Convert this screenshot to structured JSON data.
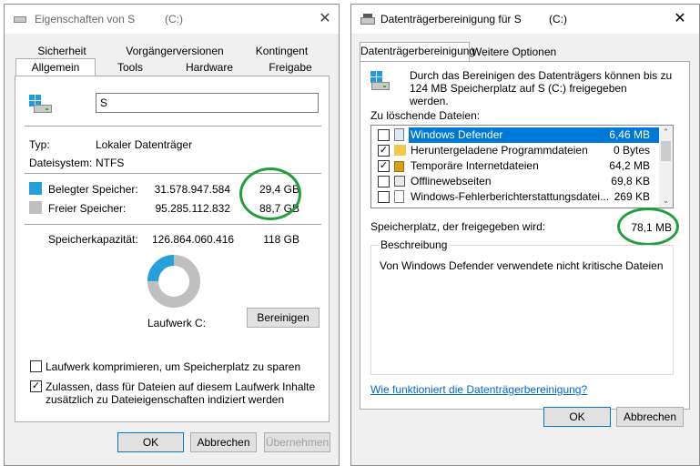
{
  "left_dialog": {
    "title": "Eigenschaften von S",
    "title_drive": "(C:)",
    "tabs_row1": [
      "Sicherheit",
      "Vorgängerversionen",
      "Kontingent"
    ],
    "tabs_row2": [
      "Allgemein",
      "Tools",
      "Hardware",
      "Freigabe"
    ],
    "volume_name": "S",
    "type_label": "Typ:",
    "type_value": "Lokaler Datenträger",
    "fs_label": "Dateisystem:",
    "fs_value": "NTFS",
    "used_label": "Belegter Speicher:",
    "used_bytes": "31.578.947.584",
    "used_gb": "29,4 GB",
    "free_label": "Freier Speicher:",
    "free_bytes": "95.285.112.832",
    "free_gb": "88,7 GB",
    "capacity_label": "Speicherkapazität:",
    "capacity_bytes": "126.864.060.416",
    "capacity_gb": "118 GB",
    "drive_label": "Laufwerk C:",
    "cleanup_button": "Bereinigen",
    "compress_label": "Laufwerk komprimieren, um Speicherplatz zu sparen",
    "index_label_line1": "Zulassen, dass für Dateien auf diesem Laufwerk Inhalte",
    "index_label_line2": "zusätzlich zu Dateieigenschaften indiziert werden",
    "ok_button": "OK",
    "cancel_button": "Abbrechen",
    "apply_button": "Übernehmen",
    "used_fraction": 0.249,
    "colors": {
      "used": "#26a0da",
      "free": "#bfbfbf",
      "accent_circle": "#1fa03a"
    }
  },
  "right_dialog": {
    "title": "Datenträgerbereinigung für S",
    "title_drive": "(C:)",
    "tabs": [
      "Datenträgerbereinigung",
      "Weitere Optionen"
    ],
    "intro_line1": "Durch das Bereinigen des Datenträgers können bis zu",
    "intro_line2": "124 MB Speicherplatz auf S",
    "intro_line2b": "(C:) freigegeben",
    "intro_line3": "werden.",
    "files_label": "Zu löschende Dateien:",
    "files": [
      {
        "name": "Windows Defender",
        "size": "6,46 MB",
        "checked": false,
        "selected": true,
        "icon": "file-icon"
      },
      {
        "name": "Heruntergeladene Programmdateien",
        "size": "0 Bytes",
        "checked": true,
        "selected": false,
        "icon": "folder-icon"
      },
      {
        "name": "Temporäre Internetdateien",
        "size": "64,2 MB",
        "checked": true,
        "selected": false,
        "icon": "lock-icon"
      },
      {
        "name": "Offlinewebseiten",
        "size": "69,8 KB",
        "checked": false,
        "selected": false,
        "icon": "offline-page-icon"
      },
      {
        "name": "Windows-Fehlerberichterstattungsdatei...",
        "size": "269 KB",
        "checked": false,
        "selected": false,
        "icon": "file-icon"
      }
    ],
    "freed_label": "Speicherplatz, der freigegeben wird:",
    "freed_value": "78,1 MB",
    "description_label": "Beschreibung",
    "description_text": "Von Windows Defender verwendete nicht kritische Dateien",
    "help_link": "Wie funktioniert die Datenträgerbereinigung?",
    "ok_button": "OK",
    "cancel_button": "Abbrechen"
  }
}
